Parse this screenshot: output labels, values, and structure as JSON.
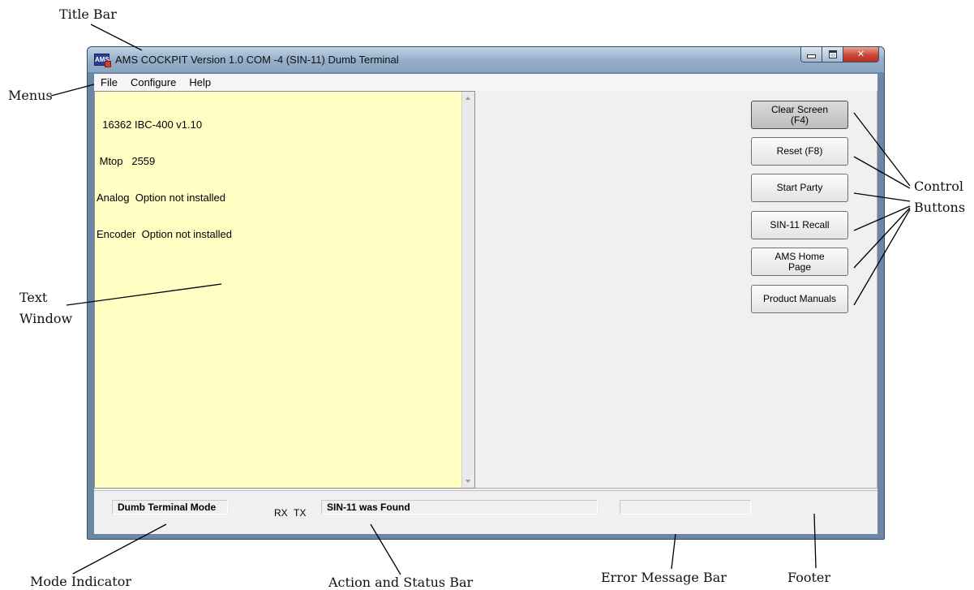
{
  "window": {
    "title": "AMS COCKPIT Version 1.0  COM -4 (SIN-11) Dumb Terminal",
    "app_icon_text": "AMS"
  },
  "menus": [
    "File",
    "Configure",
    "Help"
  ],
  "text_window": {
    "lines": [
      "  16362 IBC-400 v1.10",
      " Mtop   2559",
      "Analog  Option not installed",
      "Encoder  Option not installed"
    ]
  },
  "control_buttons": [
    {
      "line1": "Clear Screen",
      "line2": "(F4)",
      "active": true
    },
    {
      "line1": "Reset    (F8)",
      "line2": "",
      "active": false
    },
    {
      "line1": "Start Party",
      "line2": "",
      "active": false
    },
    {
      "line1": "SIN-11 Recall",
      "line2": "",
      "active": false
    },
    {
      "line1": "AMS Home",
      "line2": "Page",
      "active": false
    },
    {
      "line1": "Product Manuals",
      "line2": "",
      "active": false
    }
  ],
  "status": {
    "mode": "Dumb Terminal Mode",
    "rx": "RX",
    "tx": "TX",
    "action": "SIN-11 was Found",
    "error": ""
  },
  "annotations": {
    "title_bar": "Title Bar",
    "menus": "Menus",
    "text_window_1": "Text",
    "text_window_2": "Window",
    "control_1": "Control",
    "control_2": "Buttons",
    "mode_indicator": "Mode Indicator",
    "action_status": "Action and Status Bar",
    "error_bar": "Error Message Bar",
    "footer": "Footer"
  },
  "colors": {
    "text_window_bg": "#ffffc4",
    "frame": "#6c87a6",
    "close_button": "#c9463a"
  }
}
